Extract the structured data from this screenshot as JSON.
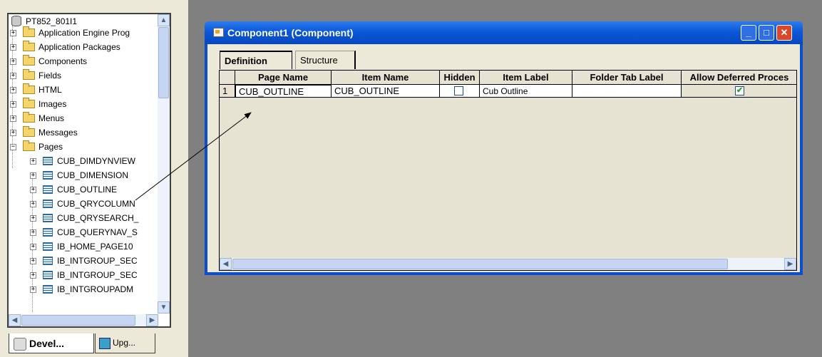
{
  "tree": {
    "root_label": "PT852_801I1",
    "items": [
      {
        "label": "Application Engine Prog",
        "kind": "folder",
        "expanded": false
      },
      {
        "label": "Application Packages",
        "kind": "folder",
        "expanded": false
      },
      {
        "label": "Components",
        "kind": "folder",
        "expanded": false
      },
      {
        "label": "Fields",
        "kind": "folder",
        "expanded": false
      },
      {
        "label": "HTML",
        "kind": "folder",
        "expanded": false
      },
      {
        "label": "Images",
        "kind": "folder",
        "expanded": false
      },
      {
        "label": "Menus",
        "kind": "folder",
        "expanded": false
      },
      {
        "label": "Messages",
        "kind": "folder",
        "expanded": false
      },
      {
        "label": "Pages",
        "kind": "folder",
        "expanded": true
      }
    ],
    "pages": [
      "CUB_DIMDYNVIEW",
      "CUB_DIMENSION",
      "CUB_OUTLINE",
      "CUB_QRYCOLUMN",
      "CUB_QRYSEARCH_",
      "CUB_QUERYNAV_S",
      "IB_HOME_PAGE10",
      "IB_INTGROUP_SEC",
      "IB_INTGROUP_SEC",
      "IB_INTGROUPADM"
    ]
  },
  "bottom_tabs": {
    "development": "Devel...",
    "upgrade": "Upg..."
  },
  "window": {
    "title": "Component1 (Component)",
    "minimize": "_",
    "maximize": "□",
    "close": "✕"
  },
  "tabs": {
    "definition": "Definition",
    "structure": "Structure"
  },
  "grid": {
    "columns": [
      "Page Name",
      "Item Name",
      "Hidden",
      "Item Label",
      "Folder Tab Label",
      "Allow Deferred Proces"
    ],
    "rows": [
      {
        "row_num": "1",
        "page_name": "CUB_OUTLINE",
        "item_name": "CUB_OUTLINE",
        "hidden": false,
        "item_label": "Cub Outline",
        "folder_tab_label": "",
        "allow_deferred": true
      }
    ]
  },
  "icons": {
    "expand": "plus-box-icon",
    "collapse": "minus-box-icon",
    "folder": "folder-icon",
    "page": "page-icon",
    "database": "database-icon",
    "scroll_up": "▲",
    "scroll_down": "▼",
    "scroll_left": "◀",
    "scroll_right": "▶",
    "check": "✔"
  },
  "colors": {
    "titlebar": "#0a58d8",
    "workspace": "#808080",
    "window_body": "#ece9d8",
    "checkbox_check": "#21a121"
  }
}
